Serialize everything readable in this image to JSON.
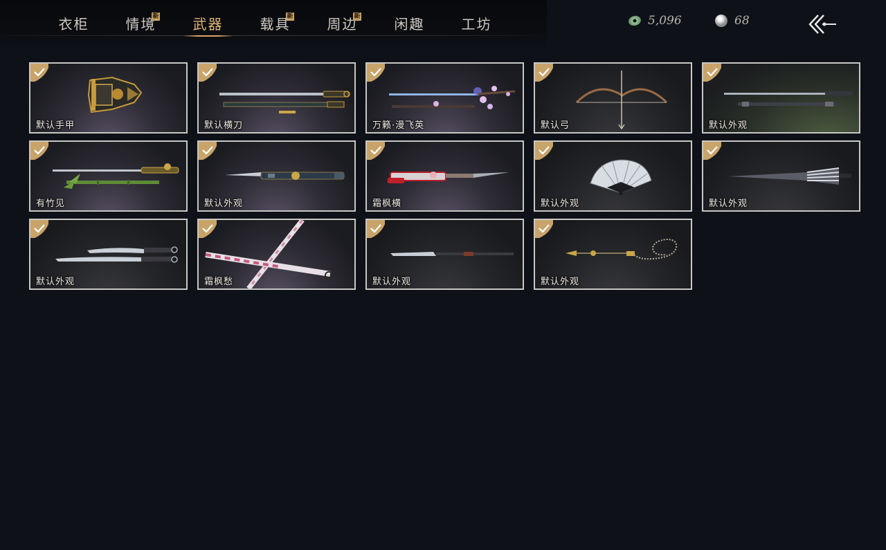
{
  "tabs": [
    {
      "label": "衣柜",
      "is_new": false,
      "active": false
    },
    {
      "label": "情境",
      "is_new": true,
      "active": false
    },
    {
      "label": "武器",
      "is_new": false,
      "active": true
    },
    {
      "label": "载具",
      "is_new": true,
      "active": false
    },
    {
      "label": "周边",
      "is_new": true,
      "active": false
    },
    {
      "label": "闲趣",
      "is_new": false,
      "active": false
    },
    {
      "label": "工坊",
      "is_new": false,
      "active": false
    }
  ],
  "new_badge_text": "新",
  "currency": {
    "jade": {
      "icon": "jade-coin-icon",
      "value": "5,096"
    },
    "pearl": {
      "icon": "pearl-icon",
      "value": "68"
    }
  },
  "back_button": {
    "icon": "back-arrow-icon"
  },
  "items": [
    {
      "name": "默认手甲",
      "owned": true,
      "icon": "gauntlet-icon"
    },
    {
      "name": "默认横刀",
      "owned": true,
      "icon": "saber-icon"
    },
    {
      "name": "万籁·漫飞英",
      "owned": true,
      "icon": "blossom-spear-icon"
    },
    {
      "name": "默认弓",
      "owned": true,
      "icon": "bow-icon"
    },
    {
      "name": "默认外观",
      "owned": true,
      "icon": "long-spear-icon"
    },
    {
      "name": "有竹见",
      "owned": true,
      "icon": "bamboo-sword-icon"
    },
    {
      "name": "默认外观",
      "owned": true,
      "icon": "sword-icon"
    },
    {
      "name": "霜枫横",
      "owned": true,
      "icon": "red-blade-icon"
    },
    {
      "name": "默认外观",
      "owned": true,
      "icon": "fan-icon"
    },
    {
      "name": "默认外观",
      "owned": true,
      "icon": "umbrella-icon"
    },
    {
      "name": "默认外观",
      "owned": true,
      "icon": "dual-blades-icon"
    },
    {
      "name": "霜枫愁",
      "owned": true,
      "icon": "crossed-swords-icon"
    },
    {
      "name": "默认外观",
      "owned": true,
      "icon": "glaive-icon"
    },
    {
      "name": "默认外观",
      "owned": true,
      "icon": "rope-dart-icon"
    }
  ],
  "colors": {
    "background": "#0e1117",
    "active_tab": "#e2b77a",
    "card_border": "#c8c8c6",
    "check_badge": "#c8a46a"
  }
}
